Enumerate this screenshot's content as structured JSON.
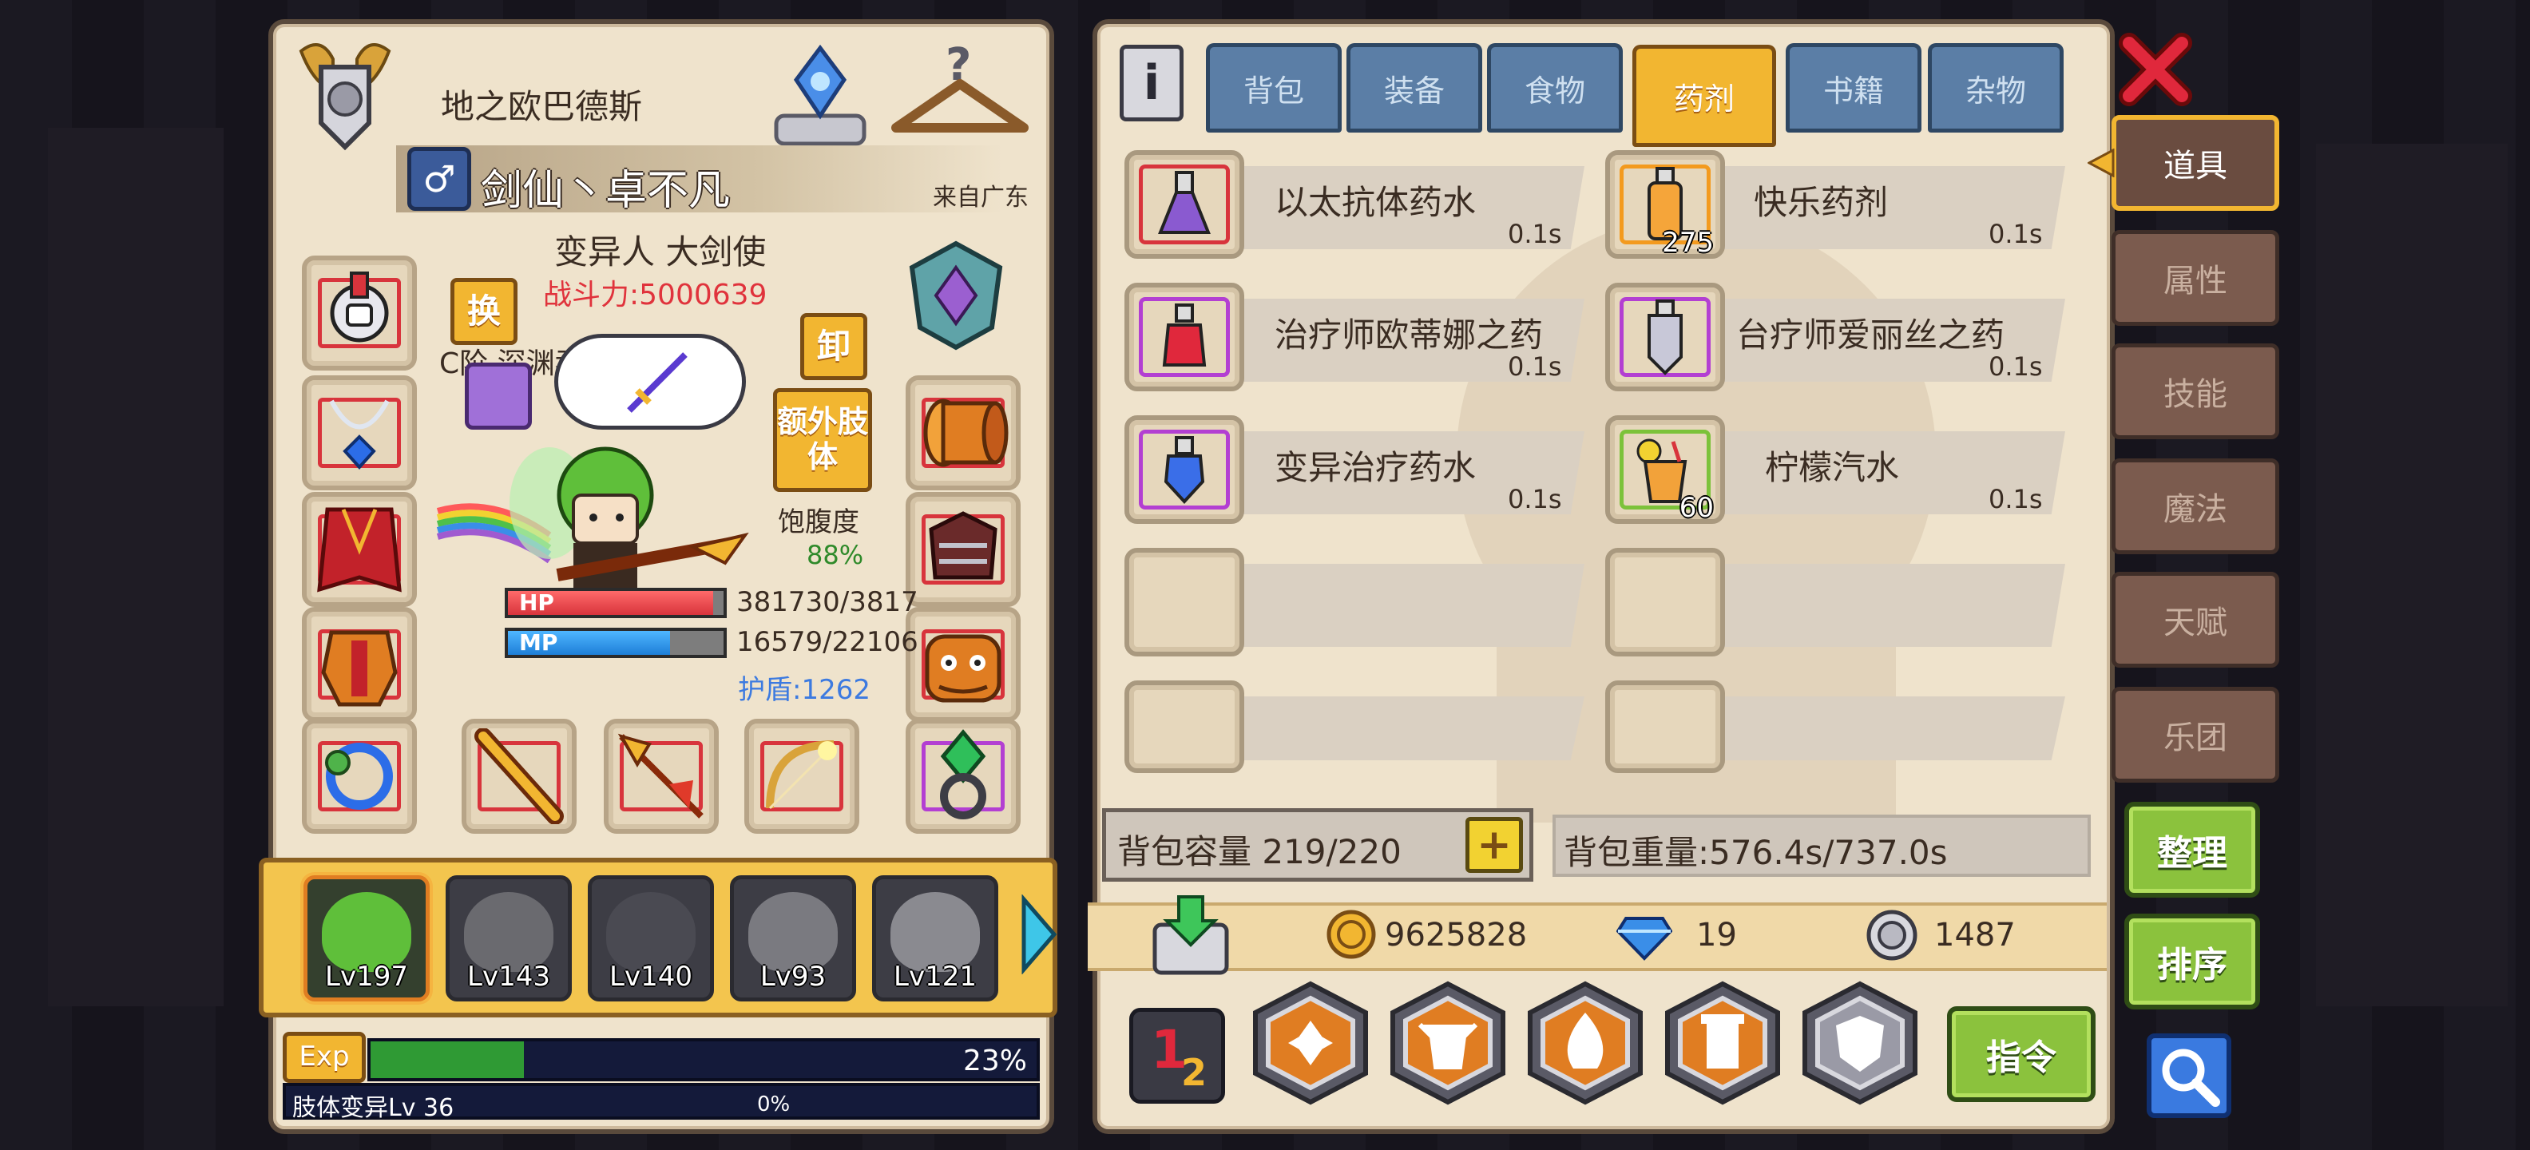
{
  "player": {
    "realm": "地之欧巴德斯",
    "name": "剑仙丶卓不凡",
    "origin": "来自广东",
    "class_title": "变异人 大剑使",
    "combat_power": "战斗力:5000639",
    "pet_line": "C阶 深渊吞噬者 Lv 40",
    "satiety_label": "饱腹度",
    "satiety_value": "88%",
    "hp_label": "HP",
    "hp_value": "381730/3817",
    "hp_fraction": 0.95,
    "mp_label": "MP",
    "mp_value": "16579/22106",
    "mp_fraction": 0.75,
    "shield": "护盾:1262"
  },
  "buttons": {
    "swap": "换",
    "unequip": "卸",
    "extra_limb": "额外肢体",
    "organize": "整理",
    "sort": "排序",
    "command": "指令"
  },
  "party": [
    {
      "level": "Lv197",
      "active": true
    },
    {
      "level": "Lv143",
      "active": false
    },
    {
      "level": "Lv140",
      "active": false
    },
    {
      "level": "Lv93",
      "active": false
    },
    {
      "level": "Lv121",
      "active": false
    }
  ],
  "exp": {
    "label": "Exp",
    "percent": "23%",
    "fraction": 0.23,
    "mutation_label": "肢体变异Lv 36",
    "mutation_percent": "0%"
  },
  "tabs": [
    {
      "label": "背包",
      "active": false
    },
    {
      "label": "装备",
      "active": false
    },
    {
      "label": "食物",
      "active": false
    },
    {
      "label": "药剂",
      "active": true
    },
    {
      "label": "书籍",
      "active": false
    },
    {
      "label": "杂物",
      "active": false
    }
  ],
  "side_tabs": [
    {
      "label": "道具",
      "active": true
    },
    {
      "label": "属性",
      "active": false
    },
    {
      "label": "技能",
      "active": false
    },
    {
      "label": "魔法",
      "active": false
    },
    {
      "label": "天赋",
      "active": false
    },
    {
      "label": "乐团",
      "active": false
    }
  ],
  "items": [
    {
      "name": "以太抗体药水",
      "weight": "0.1s",
      "count": "",
      "frame": "#d8343c",
      "color": "#8a5ad0"
    },
    {
      "name": "快乐药剂",
      "weight": "0.1s",
      "count": "275",
      "frame": "#f39a1e",
      "color": "#f5a53a"
    },
    {
      "name": "治疗师欧蒂娜之药",
      "weight": "0.1s",
      "count": "",
      "frame": "#b33fd2",
      "color": "#e0283c"
    },
    {
      "name": "台疗师爱丽丝之药",
      "weight": "0.1s",
      "count": "",
      "frame": "#b33fd2",
      "color": "#c8c8d8"
    },
    {
      "name": "变异治疗药水",
      "weight": "0.1s",
      "count": "",
      "frame": "#b33fd2",
      "color": "#3a6ee8"
    },
    {
      "name": "柠檬汽水",
      "weight": "0.1s",
      "count": "60",
      "frame": "#7cc23a",
      "color": "#f2a23a"
    }
  ],
  "capacity": {
    "label": "背包容量 219/220",
    "plus": "+"
  },
  "weight": {
    "label": "背包重量:576.4s/737.0s"
  },
  "currency": {
    "gold": "9625828",
    "diamond": "19",
    "silver": "1487"
  },
  "info_icon": "i",
  "close_icon": "✕",
  "search_icon": "magnifier"
}
